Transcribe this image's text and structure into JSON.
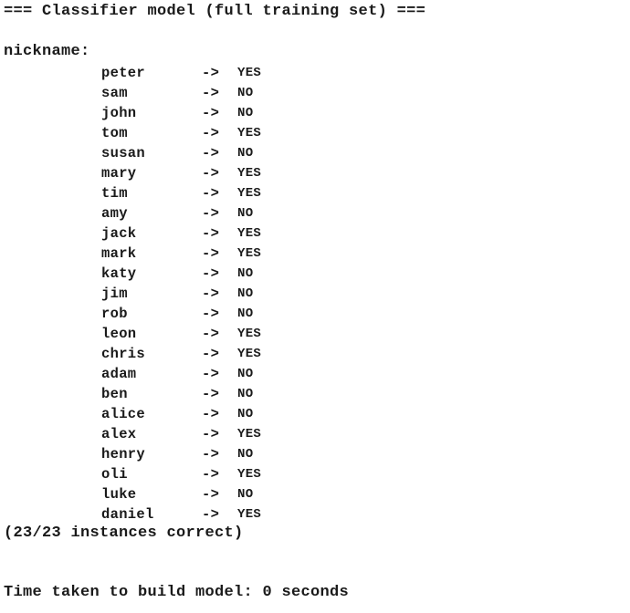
{
  "output": {
    "header": "=== Classifier model (full training set) ===",
    "attribute_label": "nickname:",
    "arrow": "->",
    "rules": [
      {
        "value": "peter",
        "class": "YES"
      },
      {
        "value": "sam",
        "class": "NO"
      },
      {
        "value": "john",
        "class": "NO"
      },
      {
        "value": "tom",
        "class": "YES"
      },
      {
        "value": "susan",
        "class": "NO"
      },
      {
        "value": "mary",
        "class": "YES"
      },
      {
        "value": "tim",
        "class": "YES"
      },
      {
        "value": "amy",
        "class": "NO"
      },
      {
        "value": "jack",
        "class": "YES"
      },
      {
        "value": "mark",
        "class": "YES"
      },
      {
        "value": "katy",
        "class": "NO"
      },
      {
        "value": "jim",
        "class": "NO"
      },
      {
        "value": "rob",
        "class": "NO"
      },
      {
        "value": "leon",
        "class": "YES"
      },
      {
        "value": "chris",
        "class": "YES"
      },
      {
        "value": "adam",
        "class": "NO"
      },
      {
        "value": "ben",
        "class": "NO"
      },
      {
        "value": "alice",
        "class": "NO"
      },
      {
        "value": "alex",
        "class": "YES"
      },
      {
        "value": "henry",
        "class": "NO"
      },
      {
        "value": "oli",
        "class": "YES"
      },
      {
        "value": "luke",
        "class": "NO"
      },
      {
        "value": "daniel",
        "class": "YES"
      }
    ],
    "summary": "(23/23 instances correct)",
    "time_taken": "Time taken to build model: 0 seconds"
  }
}
